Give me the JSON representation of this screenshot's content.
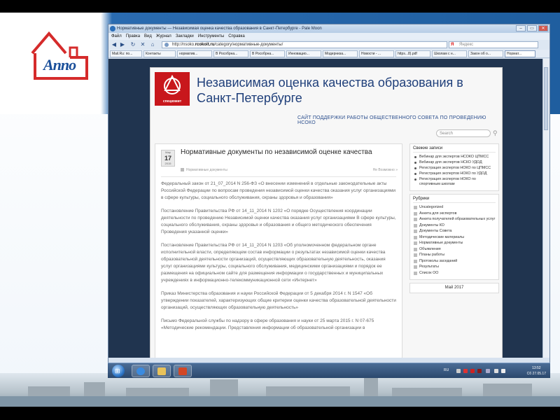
{
  "browser": {
    "window_title": "Нормативные документы — Независимая оценка качества образования в Санкт-Петербурге - Pale Moon",
    "menu": [
      "Файл",
      "Правка",
      "Вид",
      "Журнал",
      "Закладки",
      "Инструменты",
      "Справка"
    ],
    "url_prefix": "http://nsoko.",
    "url_domain": "rcokoit.ru",
    "url_path": "/category/нормативные-документы/",
    "search_engine_label": "Я",
    "search_placeholder": "Яндекс",
    "tabs": [
      "Mail.Ru: по...",
      "Контакты",
      "норматив...",
      "В Рособрна...",
      "В Рособрна...",
      "Инновацио...",
      "Модерниза...",
      "Новости - ...",
      "https...8).pdf",
      "Школам с н...",
      "Закон об о...",
      "Нормат..."
    ]
  },
  "site": {
    "logo_caption": "спецкомит",
    "title": "Независимая оценка качества образования в Санкт-Петербурге",
    "subtitle": "САЙТ ПОДДЕРЖКИ РАБОТЫ ОБЩЕСТВЕННОГО СОВЕТА ПО ПРОВЕДЕНИЮ НСОКО",
    "search_placeholder": "Search"
  },
  "post": {
    "date_month": "Мар",
    "date_day": "17",
    "date_year": "2015",
    "title": "Нормативные документы по независимой оценке качества",
    "category": "Нормативные документы",
    "comments": "Не Возможно »",
    "paragraphs": [
      "Федеральный закон от 21_07_2014 N 256-ФЗ «О внесении изменений в отдельные законодательные акты Российской Федерации по вопросам проведения независимой оценки качества оказания услуг организациями в сфере культуры, социального обслуживания, охраны здоровья и образования»",
      "Постановление Правительства РФ от 14_11_2014 N 1202 «О порядке Осуществления координации деятельности по проведению Независимой оценки качества оказания услуг организациями В сфере культуры, социального обслуживания, охраны здоровья и образования и общего методического обеспечения Проведения указанной оценки»",
      "Постановление Правительства РФ от 14_11_2014 N 1203 «Об уполномоченном федеральном органе исполнительной власти, определяющем состав информации о результатах независимой оценки качества образовательной деятельности организаций, осуществляющих образовательную деятельность, оказания услуг организациями культуры, социального обслуживания, медицинскими организациями и порядок ее размещения на официальном сайте для размещения информации о государственных и муниципальных учреждениях в информационно-телекоммуникационной сети «Интернет»",
      "Приказ Министерства образования и науки Российской Федерации от 5 декабря 2014 г. N 1547 «Об утверждении показателей, характеризующих общие критерии оценки качества образовательной деятельности организаций, осуществляющих образовательную деятельность»",
      "Письмо Федеральной службы по надзору в сфере образования и науки от 25 марта 2015 г. N 07-675 «Методические рекомендации. Представления информации об образовательной организации в"
    ]
  },
  "sidebar": {
    "recent_title": "Свежие записи",
    "recent": [
      "Вебинар для экспертов НСОКО ЦПМСС",
      "Вебинар для экспертов НСКО УДОД",
      "Регистрация экспертов НОКО по ЦПМСС",
      "Регистрация экспертов НОКО по УДОД",
      "Регистрация экспертов НОКО по спортивным школам"
    ],
    "categories_title": "Рубрики",
    "categories": [
      "Uncategorized",
      "Анкета для экспертов",
      "Анкета получателей образовательных услуг",
      "Документы КО",
      "Документы Совета",
      "Методические материалы",
      "Нормативные документы",
      "Объявления",
      "Планы работы",
      "Протоколы заседаний",
      "Результаты",
      "Список ОО"
    ],
    "calendar_title": "Май 2017"
  },
  "slide": {
    "logo_text": "Аппо"
  },
  "taskbar": {
    "lang": "RU",
    "time": "13:52",
    "date": "Сб 27.05.17"
  }
}
